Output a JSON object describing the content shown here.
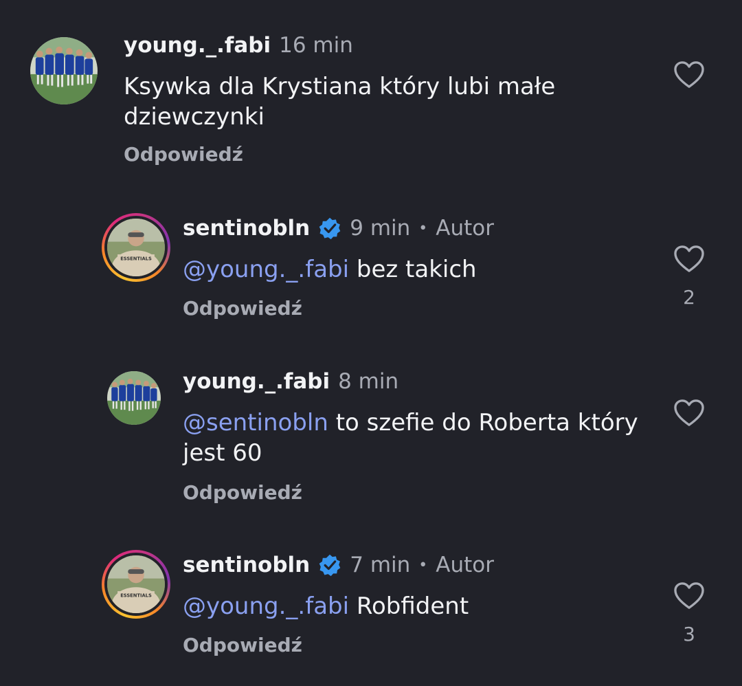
{
  "comments": [
    {
      "username": "young._.fabi",
      "time": "16 min",
      "text": "Ksywka dla Krystiana który lubi małe dziewczynki",
      "mention": "",
      "reply_label": "Odpowiedź",
      "likes": "",
      "verified": false,
      "author_label": ""
    },
    {
      "username": "sentinobln",
      "time": "9 min",
      "author_label": "Autor",
      "mention": "@young._.fabi",
      "text": " bez takich",
      "reply_label": "Odpowiedź",
      "likes": "2",
      "verified": true
    },
    {
      "username": "young._.fabi",
      "time": "8 min",
      "mention": "@sentinobln",
      "text": " to szefie do Roberta który jest 60",
      "reply_label": "Odpowiedź",
      "likes": "",
      "verified": false,
      "author_label": ""
    },
    {
      "username": "sentinobln",
      "time": "7 min",
      "author_label": "Autor",
      "mention": "@young._.fabi",
      "text": " Robfident",
      "reply_label": "Odpowiedź",
      "likes": "3",
      "verified": true
    }
  ],
  "icons": {
    "like": "heart-outline-icon",
    "verified": "verified-badge-icon"
  },
  "colors": {
    "background": "#212229",
    "mention": "#8aa0f0",
    "verified": "#3897f0",
    "muted": "#a8abb4"
  }
}
